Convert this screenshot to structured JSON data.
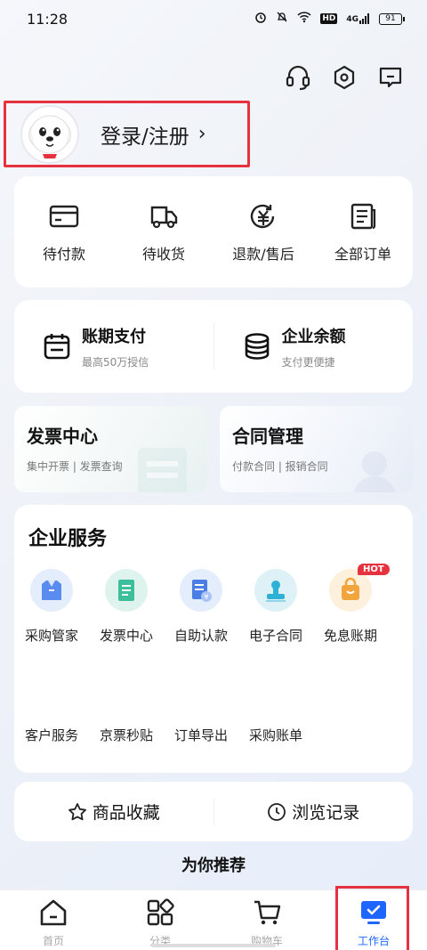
{
  "status_bar": {
    "time": "11:28",
    "icons": [
      "alarm-icon",
      "mute-icon",
      "wifi-icon",
      "hd-icon",
      "signal-icon"
    ],
    "hd": "HD",
    "signal": "4G",
    "battery": "91"
  },
  "header": {
    "login_label": "登录/注册",
    "chevron": "›"
  },
  "orders": [
    {
      "label": "待付款",
      "icon": "wallet-card-icon"
    },
    {
      "label": "待收货",
      "icon": "truck-icon"
    },
    {
      "label": "退款/售后",
      "icon": "refund-icon"
    },
    {
      "label": "全部订单",
      "icon": "order-list-icon"
    }
  ],
  "finance": [
    {
      "title": "账期支付",
      "sub": "最高50万授信",
      "icon": "calendar-icon"
    },
    {
      "title": "企业余额",
      "sub": "支付更便捷",
      "icon": "database-icon"
    }
  ],
  "documents": [
    {
      "title": "发票中心",
      "sub": "集中开票 | 发票查询"
    },
    {
      "title": "合同管理",
      "sub": "付款合同 | 报销合同"
    }
  ],
  "services": {
    "title": "企业服务",
    "items": [
      {
        "label": "采购管家",
        "icon": "purchase-manager-icon"
      },
      {
        "label": "发票中心",
        "icon": "invoice-icon"
      },
      {
        "label": "自助认款",
        "icon": "self-payment-icon"
      },
      {
        "label": "电子合同",
        "icon": "stamp-icon"
      },
      {
        "label": "免息账期",
        "icon": "shopping-bag-icon",
        "badge": "HOT"
      }
    ],
    "text_items": [
      "客户服务",
      "京票秒贴",
      "订单导出",
      "采购账单"
    ]
  },
  "history": [
    {
      "label": "商品收藏",
      "icon": "star-icon"
    },
    {
      "label": "浏览记录",
      "icon": "clock-icon"
    }
  ],
  "recommend_title": "为你推荐",
  "tabs": [
    {
      "label": "首页",
      "icon": "home-icon"
    },
    {
      "label": "分类",
      "icon": "category-icon"
    },
    {
      "label": "购物车",
      "icon": "cart-icon"
    },
    {
      "label": "工作台",
      "icon": "workbench-icon",
      "active": true
    }
  ],
  "colors": {
    "accent": "#1e66ff",
    "highlight": "#e5323e"
  }
}
